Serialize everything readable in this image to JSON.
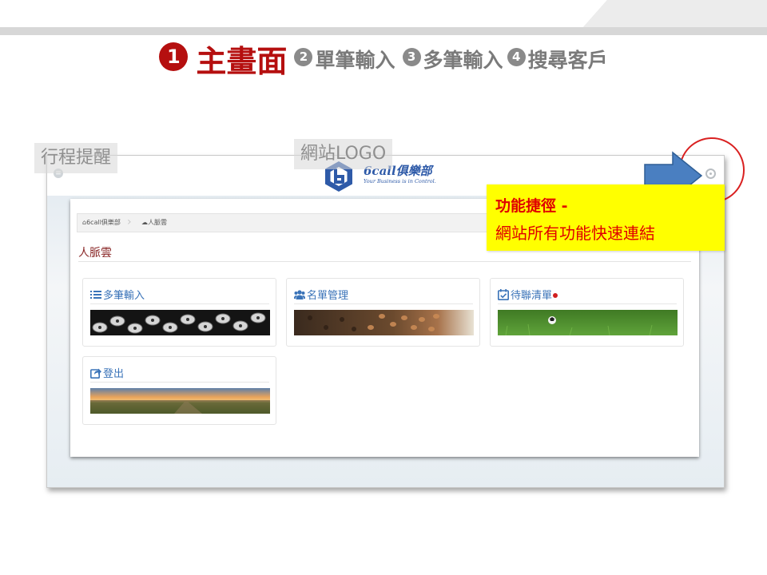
{
  "steps": {
    "main_number": "❶",
    "main_label": "主畫面",
    "others": [
      {
        "number": "❷",
        "label": "單筆輸入"
      },
      {
        "number": "❸",
        "label": "多筆輸入"
      },
      {
        "number": "❹",
        "label": "搜尋客戶"
      }
    ]
  },
  "annotations": {
    "schedule_reminder": "行程提醒",
    "site_logo": "網站LOGO",
    "shortcut_title": "功能捷徑 -",
    "shortcut_desc": "網站所有功能快速連結"
  },
  "logo": {
    "name": "6call俱樂部",
    "slogan": "Your Business is in Control."
  },
  "breadcrumb": {
    "home": "6call俱樂部",
    "current": "人脈雲"
  },
  "section_title": "人脈雲",
  "cards": [
    {
      "label": "多筆輸入",
      "icon": "list-icon",
      "image": "typewriter-keys"
    },
    {
      "label": "名單管理",
      "icon": "users-icon",
      "image": "coffee-beans"
    },
    {
      "label": "待聯清單",
      "icon": "calendar-check-icon",
      "image": "grass-field-ball",
      "badge": "red-dot"
    },
    {
      "label": "登出",
      "icon": "share-icon",
      "image": "sunset-landscape"
    }
  ],
  "colors": {
    "accent_red": "#b50f0f",
    "callout_bg": "#ffff00",
    "callout_text": "#e00000",
    "card_text": "#3a73b8",
    "arrow": "#4a7fc1"
  }
}
